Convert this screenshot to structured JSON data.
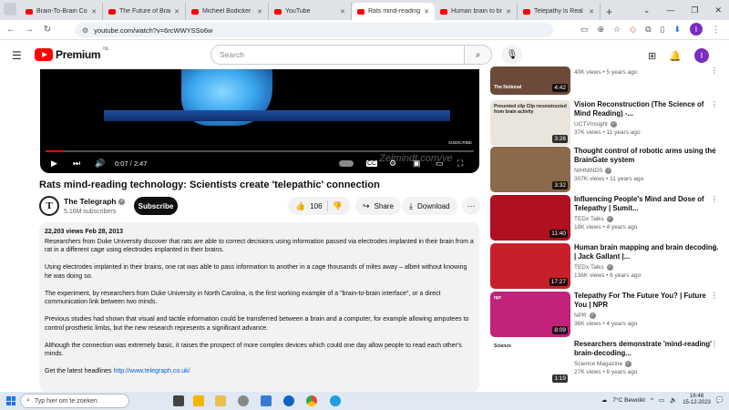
{
  "browser": {
    "tabs": [
      {
        "title": "Brain-To-Brain Comm",
        "active": false
      },
      {
        "title": "The Future of Brain-T",
        "active": false
      },
      {
        "title": "Micheel Bodicker - Y",
        "active": false
      },
      {
        "title": "YouTube",
        "active": false
      },
      {
        "title": "Rats mind-reading te",
        "active": true
      },
      {
        "title": "Human brain to brai",
        "active": false
      },
      {
        "title": "Telepathy Is Real - Y",
        "active": false
      }
    ],
    "new_tab": "+",
    "url": "youtube.com/watch?v=6rcWWYSSo6w"
  },
  "youtube": {
    "logo_text": "Premium",
    "country": "NL",
    "search_placeholder": "Search",
    "avatar_letter": "I"
  },
  "player": {
    "time": "0:07 / 2:47",
    "progress": 0.042,
    "overlay_text": "SUBSCRIBE",
    "watermark": "Zelmindt.com/ve"
  },
  "video": {
    "title": "Rats mind-reading technology: Scientists create 'telepathic' connection",
    "channel": "The Telegraph",
    "channel_initial": "T",
    "subscribers": "5.16M subscribers",
    "subscribe_label": "Subscribe",
    "likes": "106",
    "share_label": "Share",
    "download_label": "Download",
    "more": "···"
  },
  "description": {
    "meta": "22,203 views  Feb 28, 2013",
    "paragraphs": [
      "Researchers from Duke University discover that rats are able to correct decisions using information passed via electrodes implanted in their brain from a rat in a different cage using electrodes implanted in their brains.",
      "Using electrodes implanted in their brains, one rat was able to pass information to another in a cage thousands of miles away – albeit without knowing he was doing so.",
      "The experiment, by researchers from Duke University in North Carolina, is the first working example of a \"brain-to-brain interface\", or a direct communication link between two minds.",
      "Previous studies had shown that visual and tactile information could be transferred between a brain and a computer, for example allowing amputees to control prosthetic limbs, but the new research represents a significant advance.",
      "Although the connection was extremely basic, it raises the prospect of more complex devices which could one day allow people to read each other's minds."
    ],
    "link_prefix": "Get the latest headlines ",
    "link": "http://www.telegraph.co.uk/"
  },
  "sidebar": {
    "items": [
      {
        "title": "",
        "channel": "",
        "views": "40K views • 5 years ago",
        "duration": "4:42",
        "thumb_color": "#6b4a3a",
        "thumb_label": "The Notional"
      },
      {
        "title": "Vision Reconstruction (The Science of Mind Reading) -...",
        "channel": "UCTVInsight",
        "views": "37K views • 11 years ago",
        "duration": "3:26",
        "thumb_color": "#e9e4dc",
        "thumb_label": "Presented clip  Clip reconstructed from brain activity"
      },
      {
        "title": "Thought control of robotic arms using the BrainGate system",
        "channel": "NIHNINDS",
        "views": "307K views • 11 years ago",
        "duration": "3:32",
        "thumb_color": "#8a6a4a",
        "thumb_label": ""
      },
      {
        "title": "Influencing People's Mind and Dose of Telepathy | Sumit...",
        "channel": "TEDx Talks",
        "views": "18K views • 4 years ago",
        "duration": "11:40",
        "thumb_color": "#b01020",
        "thumb_label": ""
      },
      {
        "title": "Human brain mapping and brain decoding. | Jack Gallant |...",
        "channel": "TEDx Talks",
        "views": "136K views • 6 years ago",
        "duration": "17:27",
        "thumb_color": "#c8202a",
        "thumb_label": ""
      },
      {
        "title": "Telepathy For The Future You? | Future You | NPR",
        "channel": "NPR",
        "views": "36K views • 4 years ago",
        "duration": "8:09",
        "thumb_color": "#c2227a",
        "thumb_label": "npr"
      },
      {
        "title": "Researchers demonstrate 'mind-reading' brain-decoding...",
        "channel": "Science Magazine",
        "views": "27K views • 6 years ago",
        "duration": "1:19",
        "thumb_color": "#ffffff",
        "thumb_label": "Science"
      }
    ]
  },
  "taskbar": {
    "search_placeholder": "Typ hier om te zoeken",
    "weather": "7°C  Bewolkt",
    "time": "16:48",
    "date": "15-12-2023"
  }
}
